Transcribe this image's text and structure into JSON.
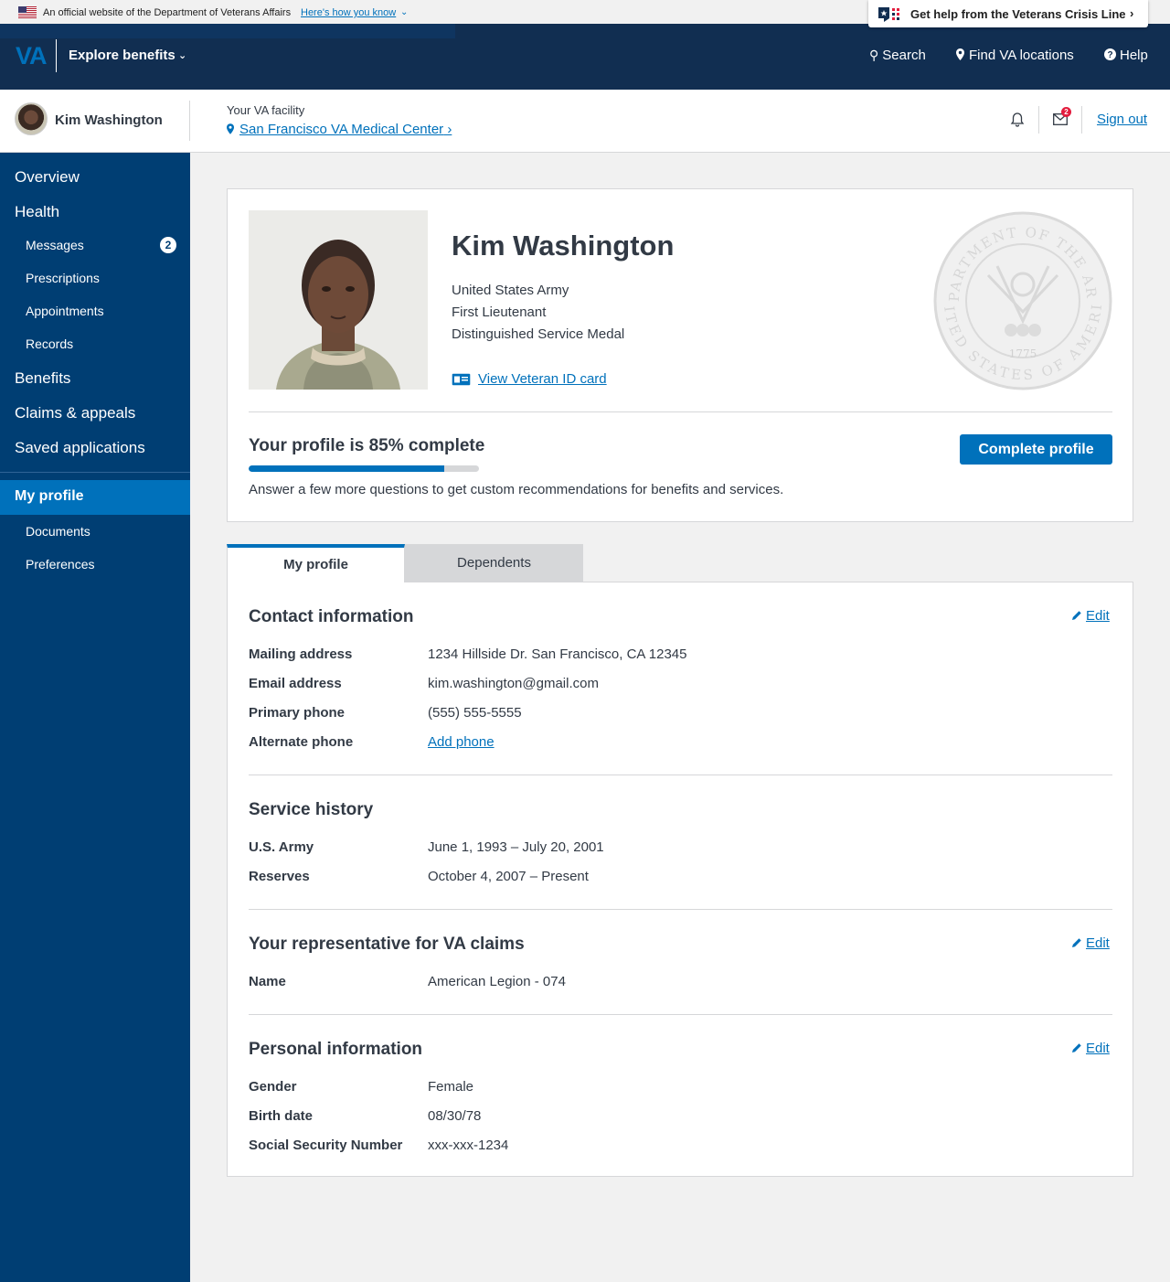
{
  "gov_banner": {
    "official_text": "An official website of the Department of Veterans Affairs",
    "how_you_know": "Here's how you know",
    "crisis_line": "Get help from the Veterans Crisis Line"
  },
  "header": {
    "logo": "VA",
    "explore": "Explore benefits",
    "nav": {
      "search": "Search",
      "locations": "Find VA locations",
      "help": "Help"
    }
  },
  "userbar": {
    "user_name": "Kim Washington",
    "facility_label": "Your VA facility",
    "facility_name": "San Francisco VA Medical Center",
    "mail_count": "2",
    "sign_out": "Sign out"
  },
  "sidebar": {
    "overview": "Overview",
    "health": "Health",
    "messages": "Messages",
    "messages_count": "2",
    "prescriptions": "Prescriptions",
    "appointments": "Appointments",
    "records": "Records",
    "benefits": "Benefits",
    "claims": "Claims & appeals",
    "saved_apps": "Saved applications",
    "my_profile": "My profile",
    "documents": "Documents",
    "preferences": "Preferences"
  },
  "profile": {
    "name": "Kim Washington",
    "branch": "United States Army",
    "rank": "First Lieutenant",
    "award": "Distinguished Service Medal",
    "id_card_link": "View Veteran ID card",
    "seal_text_top": "DEPARTMENT OF THE ARMY",
    "seal_text_bottom": "UNITED STATES OF AMERICA",
    "seal_year": "1775",
    "completion_title": "Your profile is 85% complete",
    "completion_pct": 85,
    "completion_desc": "Answer a few more questions to get custom recommendations for benefits and services.",
    "complete_button": "Complete profile"
  },
  "tabs": {
    "my_profile": "My profile",
    "dependents": "Dependents"
  },
  "contact": {
    "heading": "Contact information",
    "edit": "Edit",
    "mailing_label": "Mailing address",
    "mailing_value": "1234 Hillside Dr. San Francisco, CA 12345",
    "email_label": "Email address",
    "email_value": "kim.washington@gmail.com",
    "primary_label": "Primary phone",
    "primary_value": "(555) 555-5555",
    "alternate_label": "Alternate phone",
    "alternate_link": "Add phone"
  },
  "service": {
    "heading": "Service history",
    "army_label": "U.S. Army",
    "army_value": "June 1, 1993 – July 20, 2001",
    "reserves_label": "Reserves",
    "reserves_value": "October 4, 2007 – Present"
  },
  "representative": {
    "heading": "Your representative for VA claims",
    "edit": "Edit",
    "name_label": "Name",
    "name_value": "American Legion - 074"
  },
  "personal": {
    "heading": "Personal information",
    "edit": "Edit",
    "gender_label": "Gender",
    "gender_value": "Female",
    "birth_label": "Birth date",
    "birth_value": "08/30/78",
    "ssn_label": "Social Security Number",
    "ssn_value": "xxx-xxx-1234"
  },
  "colors": {
    "header_navy": "#112e51",
    "sidebar_blue": "#003e73",
    "accent_blue": "#0071bb",
    "alert_red": "#e31c3d"
  }
}
